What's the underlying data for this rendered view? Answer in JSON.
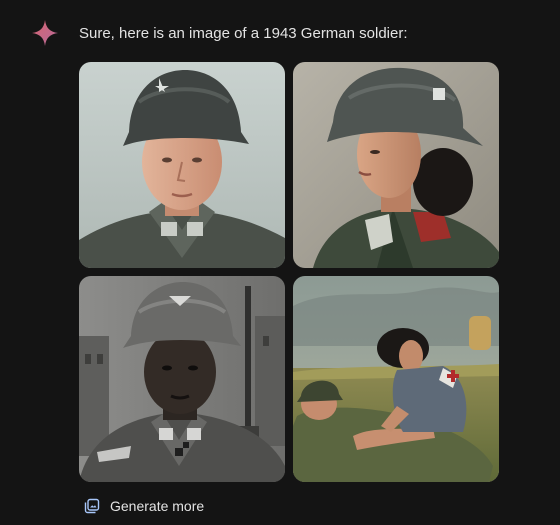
{
  "response": {
    "text": "Sure, here is an image of a 1943 German soldier:",
    "icon": "gemini-sparkle-icon"
  },
  "images": [
    {
      "icon": "portrait-image"
    },
    {
      "icon": "portrait-image"
    },
    {
      "icon": "portrait-image"
    },
    {
      "icon": "scene-image"
    }
  ],
  "actions": {
    "generate_more_label": "Generate more",
    "generate_more_icon": "image-stack-icon"
  },
  "colors": {
    "background": "#141414",
    "text": "#e3e3e3",
    "sparkle_start": "#d96570",
    "sparkle_end": "#9b72cb"
  }
}
